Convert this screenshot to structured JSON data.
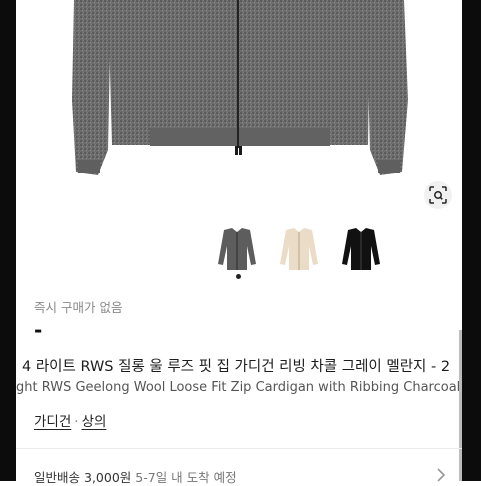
{
  "product": {
    "status": "즉시 구매가 없음",
    "price": "-",
    "title_ko": "4 라이트 RWS 질롱 울 루즈 핏 집 가디건 리빙 차콜 그레이 멜란지 - 2",
    "title_en": "ght RWS Geelong Wool Loose Fit Zip Cardigan with Ribbing Charcoal",
    "categories": [
      "가디건",
      "상의"
    ],
    "category_sep": "·"
  },
  "shipping": {
    "method": "일반배송",
    "fee": "3,000원",
    "eta": "5-7일 내 도착 예정"
  },
  "thumbnails": [
    {
      "name": "charcoal",
      "color": "#5a5a5a"
    },
    {
      "name": "beige",
      "color": "#e9dcc7"
    },
    {
      "name": "black",
      "color": "#121212"
    }
  ],
  "icons": {
    "zoom": "image-search-icon",
    "chevron": "chevron-right-icon"
  },
  "colors": {
    "knit": "#6d6d6d",
    "text_primary": "#111111",
    "text_muted": "#8a8a8a"
  }
}
